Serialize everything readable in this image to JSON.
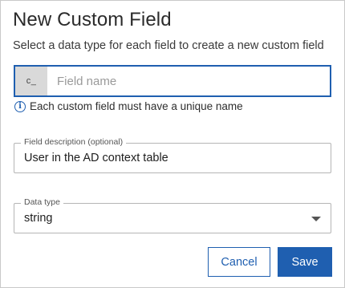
{
  "dialog": {
    "title": "New Custom Field",
    "subtitle": "Select a data type for each field to create a new custom field"
  },
  "field_name": {
    "prefix": "c_",
    "placeholder": "Field name",
    "value": "",
    "hint": "Each custom field must have a unique name",
    "hint_icon": "info-icon"
  },
  "description": {
    "legend": "Field description (optional)",
    "value": "User in the AD context table"
  },
  "data_type": {
    "legend": "Data type",
    "value": "string",
    "icon": "chevron-down-icon"
  },
  "actions": {
    "cancel_label": "Cancel",
    "save_label": "Save"
  },
  "colors": {
    "accent": "#1f5fb0",
    "prefix_bg": "#d9d9d9"
  }
}
